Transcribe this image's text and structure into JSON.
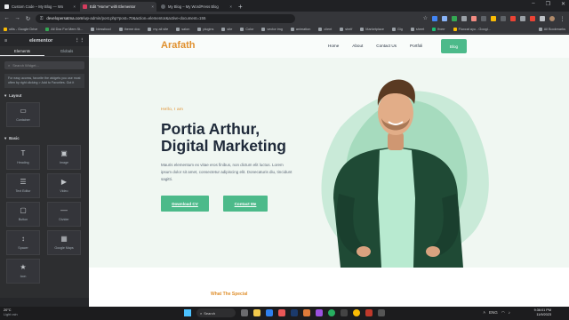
{
  "tabs": [
    {
      "title": "Custom Code – My Blog — Wo",
      "color": "#e8eaed"
    },
    {
      "title": "Edit \"Home\" with Elementor",
      "color": "#d53c5e"
    },
    {
      "title": "My Blog – My WordPress Blog",
      "color": "#5f6368"
    }
  ],
  "omnibox": {
    "host": "developersatma.com",
    "path": "/wp-admin/post.php?post=70&action=elementor&active-document=155"
  },
  "bookmarks": [
    "utils - Google Drive",
    "All Doc For Mem St...",
    "blessfood",
    "theme doc",
    "my all site",
    "salon",
    "plugins",
    "site",
    "Color",
    "vector img",
    "animation",
    "client",
    "shelf",
    "Marketplace",
    "Gig",
    "sheet",
    "fiverr"
  ],
  "bookmarks_tail": "Fluxcat ayu - Googl...",
  "all_bookmarks": "All Bookmarks",
  "panel": {
    "brand": "elementor",
    "tabs": [
      "Elements",
      "Globals"
    ],
    "search_placeholder": "Search Widget...",
    "note": "For easy access, favorite the widgets you use most often by right clicking > Add to Favorites. Got it",
    "sections": [
      {
        "title": "Layout",
        "widgets": [
          {
            "label": "Container",
            "icon": "container-icon"
          }
        ]
      },
      {
        "title": "Basic",
        "widgets": [
          {
            "label": "Heading",
            "icon": "heading-icon"
          },
          {
            "label": "Image",
            "icon": "image-icon"
          },
          {
            "label": "Text Editor",
            "icon": "text-editor-icon"
          },
          {
            "label": "Video",
            "icon": "video-icon"
          },
          {
            "label": "Button",
            "icon": "button-icon"
          },
          {
            "label": "Divider",
            "icon": "divider-icon"
          },
          {
            "label": "Spacer",
            "icon": "spacer-icon"
          },
          {
            "label": "Google Maps",
            "icon": "map-icon"
          },
          {
            "label": "Icon",
            "icon": "star-icon"
          }
        ]
      }
    ]
  },
  "site": {
    "logo": "Arafath",
    "nav": [
      "Home",
      "About",
      "Contact Us",
      "Portfoli"
    ],
    "nav_button": "Blog",
    "greeting": "Hello, I am",
    "heading_line1": "Portia Arthur,",
    "heading_line2": "Digital Marketing",
    "description": "Mauris elementum ex vitae eros finibus, non dictum elit luctus. Lorem ipsum dolor sit amet, consectetur adipiscing elit. Donecaturis diu, tincidunt sagitti.",
    "btn_download": "Download CV",
    "btn_contact": "Contact Me",
    "section_title": "What The Special",
    "accent": "#4cba8a",
    "orange": "#e0902e"
  },
  "taskbar": {
    "temp": "20°C",
    "condition": "Light rain",
    "search": "Search",
    "time": "9:36:01 PM",
    "date": "11/9/2023",
    "lang": "ENG"
  }
}
